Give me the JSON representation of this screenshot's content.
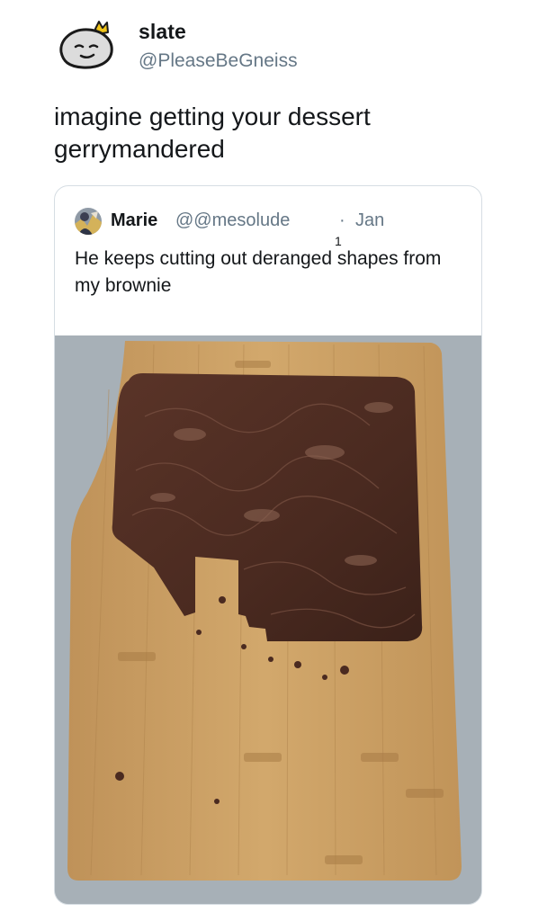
{
  "tweet": {
    "display_name": "slate",
    "handle": "@PleaseBeGneiss",
    "text": "imagine getting your dessert gerrymandered",
    "avatar_icon": "rock-with-crown-avatar"
  },
  "quoted_tweet": {
    "display_name": "Marie",
    "handle": "@@mesolude",
    "separator": "·",
    "date": "Jan",
    "date_sub": "1",
    "text": "He keeps cutting out deranged shapes from my brownie",
    "avatar_icon": "user-avatar",
    "photo": {
      "subject": "brownie-on-cutting-board-photo"
    }
  },
  "colors": {
    "text_primary": "#14171a",
    "text_secondary": "#657786",
    "card_border": "#d6dde3",
    "board_wood": "#c89d62",
    "brownie": "#4a2a20"
  }
}
